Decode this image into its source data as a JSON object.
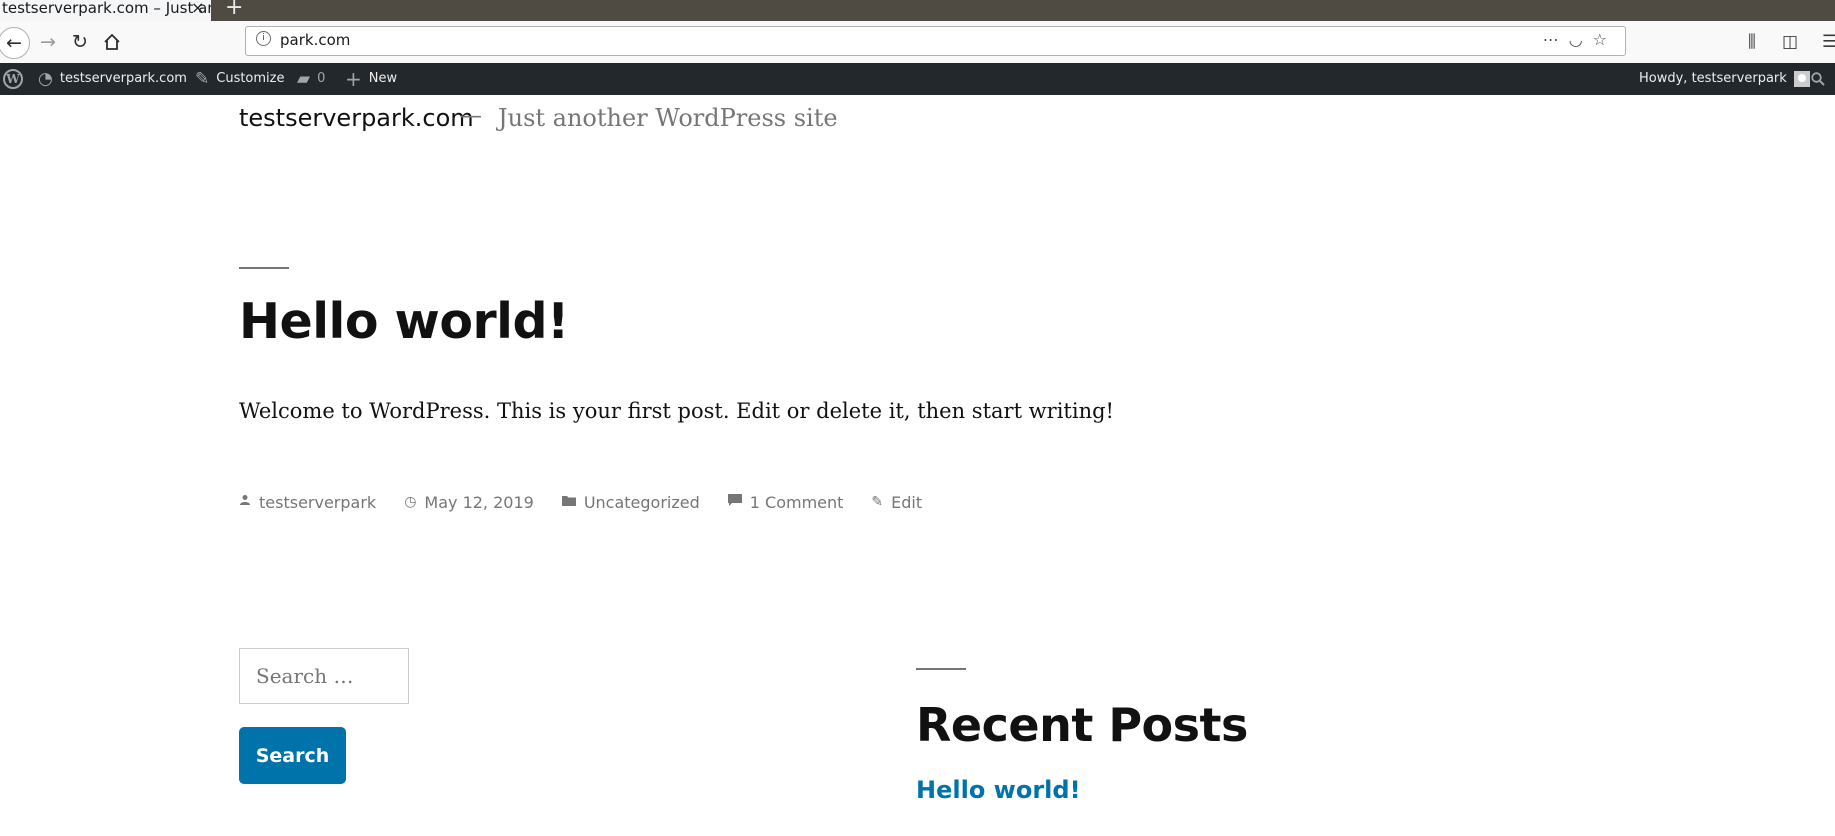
{
  "browser": {
    "tab_title": "testserverpark.com – Just another WordPress site",
    "tab_close": "×",
    "new_tab": "+",
    "url": "park.com"
  },
  "adminbar": {
    "site_name": "testserverpark.com",
    "customize": "Customize",
    "comments_count": "0",
    "new_label": "New",
    "howdy": "Howdy, testserverpark"
  },
  "site": {
    "title": "testserverpark.com",
    "separator": "—",
    "description": "Just another WordPress site"
  },
  "post": {
    "title": "Hello world!",
    "body": "Welcome to WordPress. This is your first post. Edit or delete it, then start writing!",
    "author": "testserverpark",
    "date": "May 12, 2019",
    "category": "Uncategorized",
    "comments": "1 Comment",
    "edit": "Edit"
  },
  "widgets": {
    "search_placeholder": "Search …",
    "search_button": "Search",
    "recent_posts_title": "Recent Posts",
    "recent_posts": [
      "Hello world!"
    ]
  },
  "colors": {
    "adminbar_bg": "#23282d",
    "accent": "#0073aa",
    "meta_gray": "#767676"
  }
}
